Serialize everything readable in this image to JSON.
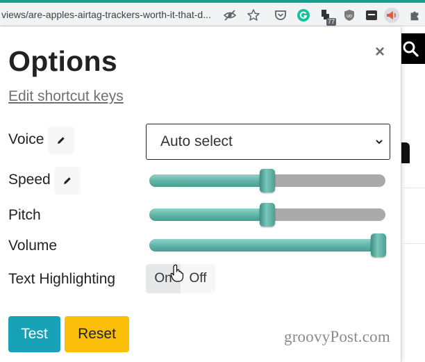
{
  "browser": {
    "url": "views/are-apples-airtag-trackers-worth-it-that-d...",
    "extension_badge": "77"
  },
  "options": {
    "title": "Options",
    "close_symbol": "×",
    "shortcut_link": "Edit shortcut keys",
    "voice": {
      "label": "Voice",
      "selected": "Auto select"
    },
    "speed": {
      "label": "Speed",
      "level": 0.5
    },
    "pitch": {
      "label": "Pitch",
      "level": 0.5
    },
    "volume": {
      "label": "Volume",
      "level": 1.0
    },
    "text_highlighting": {
      "label": "Text Highlighting",
      "on_label": "On",
      "off_label": "Off",
      "active": "On"
    },
    "buttons": {
      "test": "Test",
      "reset": "Reset"
    }
  },
  "watermark": "groovyPost.com",
  "colors": {
    "accent": "#1a9e8f",
    "slider_fill": "#5fb3a6",
    "test_button": "#18a2b8",
    "reset_button": "#fbbf0a"
  },
  "icons": [
    "eye-slash-icon",
    "star-icon",
    "pocket-icon",
    "grammarly-icon",
    "extension-icon",
    "ublock-icon",
    "extension-square-icon",
    "read-aloud-icon",
    "puzzle-icon",
    "pencil-icon",
    "search-icon",
    "chevron-down-icon",
    "hand-cursor-icon"
  ]
}
